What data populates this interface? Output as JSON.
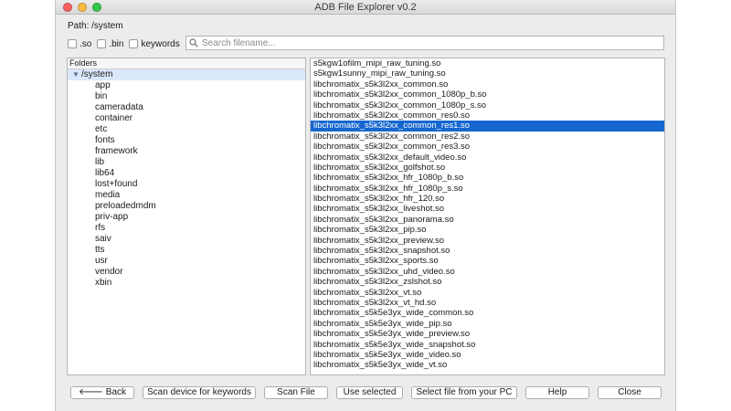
{
  "window": {
    "title": "ADB File Explorer v0.2"
  },
  "path": {
    "label": "Path: /system"
  },
  "filters": [
    {
      "label": ".so",
      "checked": false
    },
    {
      "label": ".bin",
      "checked": false
    },
    {
      "label": "keywords",
      "checked": false
    }
  ],
  "search": {
    "placeholder": "Search filename...",
    "value": "",
    "icon": "search-icon"
  },
  "folders": {
    "header": "Folders",
    "root": {
      "label": "/system",
      "expanded": true,
      "icon": "triangle-down-icon"
    },
    "children": [
      "app",
      "bin",
      "cameradata",
      "container",
      "etc",
      "fonts",
      "framework",
      "lib",
      "lib64",
      "lost+found",
      "media",
      "preloadedmdm",
      "priv-app",
      "rfs",
      "saiv",
      "tts",
      "usr",
      "vendor",
      "xbin"
    ]
  },
  "files": {
    "selected_index": 5,
    "items": [
      "s5kgw1ofilm_mipi_raw_tuning.so",
      "s5kgw1sunny_mipi_raw_tuning.so",
      "libchromatix_s5k3l2xx_common.so",
      "libchromatix_s5k3l2xx_common_1080p_b.so",
      "libchromatix_s5k3l2xx_common_1080p_s.so",
      "libchromatix_s5k3l2xx_common_res0.so",
      "libchromatix_s5k3l2xx_common_res1.so",
      "libchromatix_s5k3l2xx_common_res2.so",
      "libchromatix_s5k3l2xx_common_res3.so",
      "libchromatix_s5k3l2xx_default_video.so",
      "libchromatix_s5k3l2xx_golfshot.so",
      "libchromatix_s5k3l2xx_hfr_1080p_b.so",
      "libchromatix_s5k3l2xx_hfr_1080p_s.so",
      "libchromatix_s5k3l2xx_hfr_120.so",
      "libchromatix_s5k3l2xx_liveshot.so",
      "libchromatix_s5k3l2xx_panorama.so",
      "libchromatix_s5k3l2xx_pip.so",
      "libchromatix_s5k3l2xx_preview.so",
      "libchromatix_s5k3l2xx_snapshot.so",
      "libchromatix_s5k3l2xx_sports.so",
      "libchromatix_s5k3l2xx_uhd_video.so",
      "libchromatix_s5k3l2xx_zslshot.so",
      "libchromatix_s5k3l2xx_vt.so",
      "libchromatix_s5k3l2xx_vt_hd.so",
      "libchromatix_s5k5e3yx_wide_common.so",
      "libchromatix_s5k5e3yx_wide_pip.so",
      "libchromatix_s5k5e3yx_wide_preview.so",
      "libchromatix_s5k5e3yx_wide_snapshot.so",
      "libchromatix_s5k5e3yx_wide_video.so",
      "libchromatix_s5k5e3yx_wide_vt.so"
    ]
  },
  "buttons": {
    "back": "Back",
    "back_icon": "arrow-left-icon",
    "scan_device": "Scan device for keywords",
    "scan_file": "Scan File",
    "use_selected": "Use selected",
    "select_file": "Select file from your PC",
    "help": "Help",
    "close": "Close"
  },
  "colors": {
    "selection": "#1667d0",
    "tree_root_highlight": "#dbe7fb"
  }
}
